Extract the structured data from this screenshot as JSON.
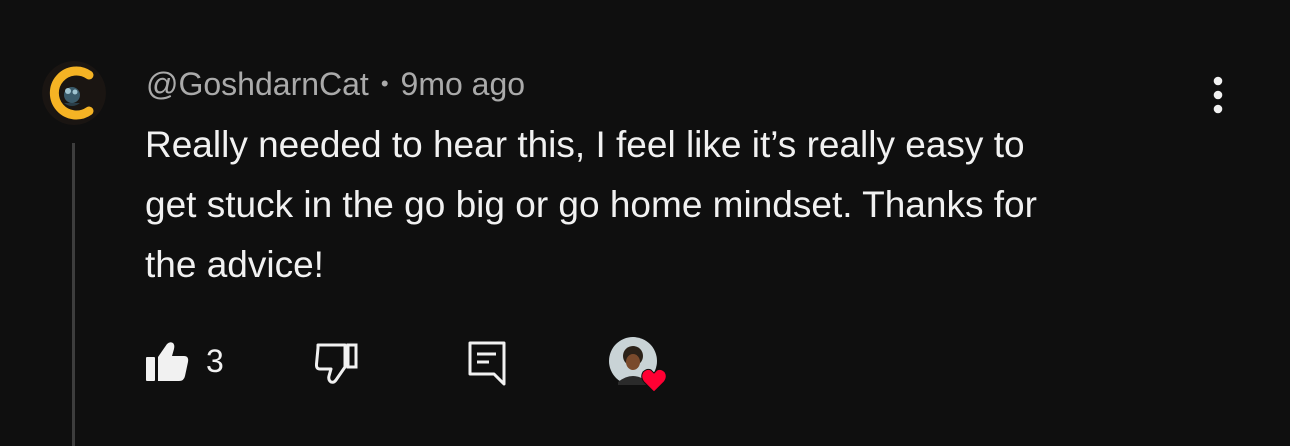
{
  "comment": {
    "author": "@GoshdarnCat",
    "separator": "•",
    "timestamp": "9mo ago",
    "text": "Really needed to hear this, I feel like it’s really easy to\nget stuck in the go big or go home mindset. Thanks for\nthe advice!",
    "like_count": "3",
    "hearted": true
  },
  "icons": {
    "menu": "more-vert-icon",
    "like": "thumb-up-icon",
    "dislike": "thumb-down-icon",
    "reply": "reply-icon",
    "heart": "heart-icon"
  },
  "colors": {
    "background": "#0f0f0f",
    "text_primary": "#f1f1f1",
    "text_secondary": "#aaaaaa",
    "avatar_ring": "#f5b324",
    "heart": "#ff0033"
  }
}
